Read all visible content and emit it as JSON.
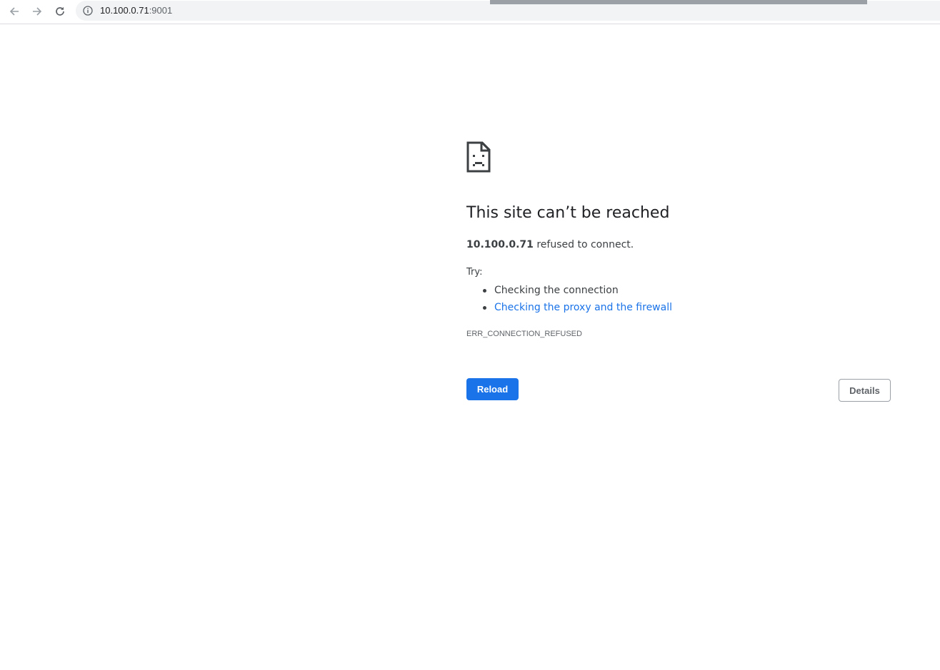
{
  "browser": {
    "url_host": "10.100.0.71",
    "url_port": ":9001",
    "icons": {
      "back": "back-arrow-icon",
      "forward": "forward-arrow-icon",
      "reload": "reload-icon",
      "site_info": "info-icon"
    }
  },
  "error_page": {
    "icon": "sad-page-icon",
    "heading": "This site can’t be reached",
    "host": "10.100.0.71",
    "summary_rest": " refused to connect.",
    "try_label": "Try:",
    "suggestions": [
      "Checking the connection",
      "Checking the proxy and the firewall"
    ],
    "error_code": "ERR_CONNECTION_REFUSED",
    "reload_label": "Reload",
    "details_label": "Details"
  },
  "colors": {
    "primary_button": "#1a73e8",
    "link": "#1a73e8",
    "text": "#202124"
  }
}
